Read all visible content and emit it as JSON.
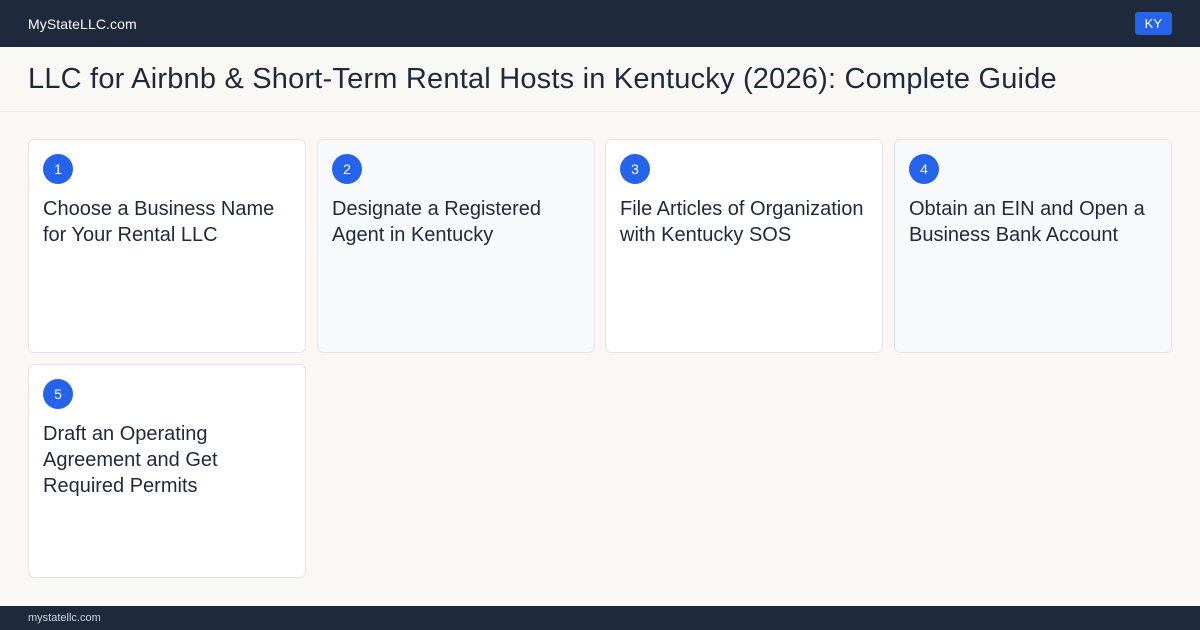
{
  "header": {
    "brand": "MyStateLLC.com",
    "state_badge": "KY"
  },
  "page": {
    "title": "LLC for Airbnb & Short-Term Rental Hosts in Kentucky (2026): Complete Guide"
  },
  "steps": [
    {
      "number": "1",
      "title": "Choose a Business Name for Your Rental LLC"
    },
    {
      "number": "2",
      "title": "Designate a Registered Agent in Kentucky"
    },
    {
      "number": "3",
      "title": "File Articles of Organization with Kentucky SOS"
    },
    {
      "number": "4",
      "title": "Obtain an EIN and Open a Business Bank Account"
    },
    {
      "number": "5",
      "title": "Draft an Operating Agreement and Get Required Permits"
    }
  ],
  "footer": {
    "url": "mystatellc.com"
  },
  "colors": {
    "nav_bg": "#1e293b",
    "accent": "#2563eb",
    "page_bg": "#f9f8f4"
  }
}
